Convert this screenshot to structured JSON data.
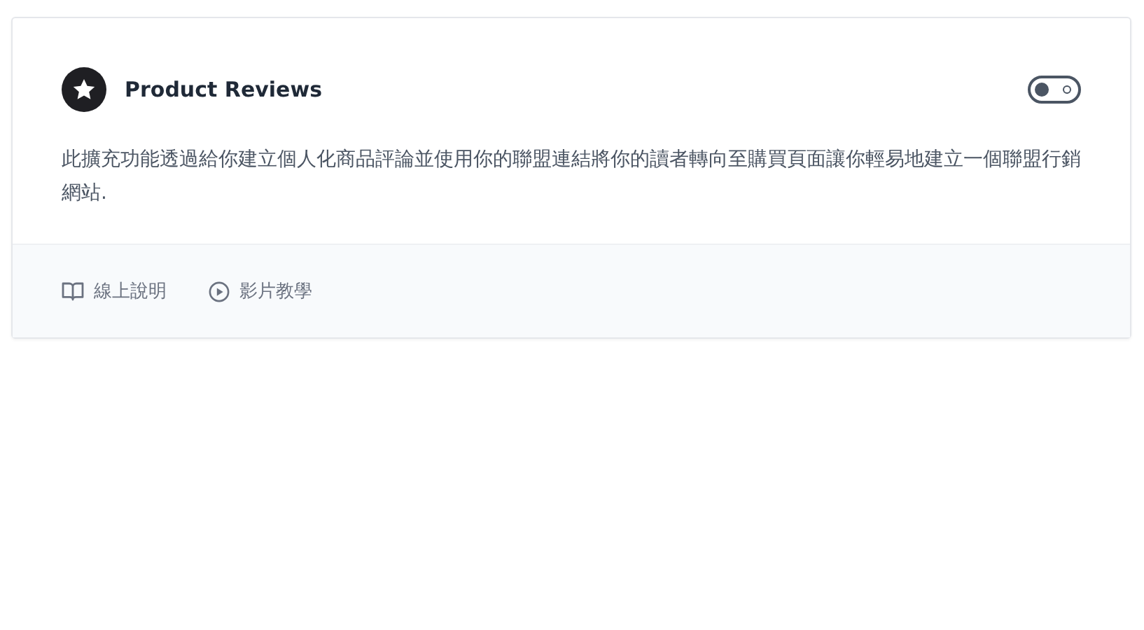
{
  "card": {
    "title": "Product Reviews",
    "enabled": false,
    "description": "此擴充功能透過給你建立個人化商品評論並使用你的聯盟連結將你的讀者轉向至購買頁面讓你輕易地建立一個聯盟行銷網站.",
    "links": [
      {
        "kind": "docs",
        "label": "線上說明"
      },
      {
        "kind": "video",
        "label": "影片教學"
      }
    ]
  }
}
